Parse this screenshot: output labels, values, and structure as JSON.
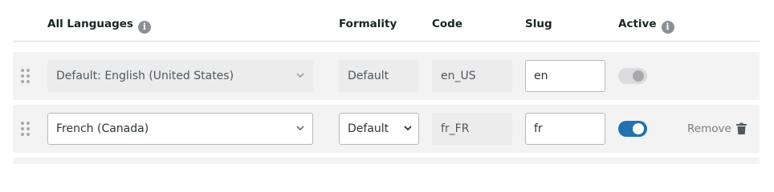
{
  "header": {
    "all_languages": "All Languages",
    "formality": "Formality",
    "code": "Code",
    "slug": "Slug",
    "active": "Active",
    "info_icon": "info-icon"
  },
  "rows": [
    {
      "language": "Default: English (United States)",
      "formality": "Default",
      "code": "en_US",
      "slug": "en",
      "active": true,
      "active_editable": false
    },
    {
      "language": "French (Canada)",
      "formality": "Default",
      "code": "fr_FR",
      "slug": "fr",
      "active": true,
      "active_editable": true,
      "remove_label": "Remove"
    }
  ],
  "colors": {
    "accent": "#2271b1",
    "row_background": "#f3f3f3",
    "disabled_field": "#ececec"
  }
}
